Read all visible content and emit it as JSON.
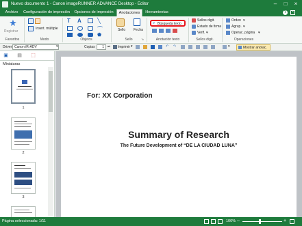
{
  "window": {
    "title": "Nuevo documento 1 - Canon imageRUNNER ADVANCE Desktop - Editor"
  },
  "menu_tabs": [
    {
      "label": "Archivo"
    },
    {
      "label": "Configuración de impresión"
    },
    {
      "label": "Opciones de impresión"
    },
    {
      "label": "Anotaciones",
      "active": true
    },
    {
      "label": "Herramientas"
    }
  ],
  "ribbon": {
    "favorites": {
      "register_label": "Registrar",
      "group_label": "Favoritos"
    },
    "mode": {
      "insert_label": "Insert. múltiple",
      "group_label": "Modo"
    },
    "objects": {
      "group_label": "Objetos"
    },
    "stamp": {
      "sello_label": "Sello",
      "fecha_label": "Fecha",
      "group_label": "Sello"
    },
    "text_annotation": {
      "search_label": "Búsqueda texto",
      "group_label": "Anotación texto"
    },
    "digital_stamps": {
      "sellos_label": "Sellos digit.",
      "estado_label": "Estado de firma",
      "verif_label": "Verif.",
      "group_label": "Sellos digit."
    },
    "operations": {
      "orden_label": "Orden",
      "agrup_label": "Agrup.",
      "operac_label": "Operac. página",
      "group_label": "Operaciones"
    }
  },
  "toolbar": {
    "driver_label": "Driver",
    "driver_value": "Canon iR-ADV",
    "copies_label": "Copias",
    "copies_value": "1",
    "print_label": "Imprimir",
    "show_annotations_label": "Mostrar anotac."
  },
  "left_pane": {
    "title": "Miniaturas",
    "pages": [
      "1",
      "2",
      "3"
    ]
  },
  "document": {
    "for_line": "For: XX Corporation",
    "heading": "Summary of Research",
    "subheading": "The Future Development of “DE LA CIUDAD LUNA”"
  },
  "status": {
    "selected_pages": "Página seleccionada: 1/11",
    "zoom": "100%"
  },
  "colors": {
    "brand_green": "#1e7b3c",
    "highlight_red": "#e8141b",
    "icon_blue": "#1e5fb3"
  }
}
